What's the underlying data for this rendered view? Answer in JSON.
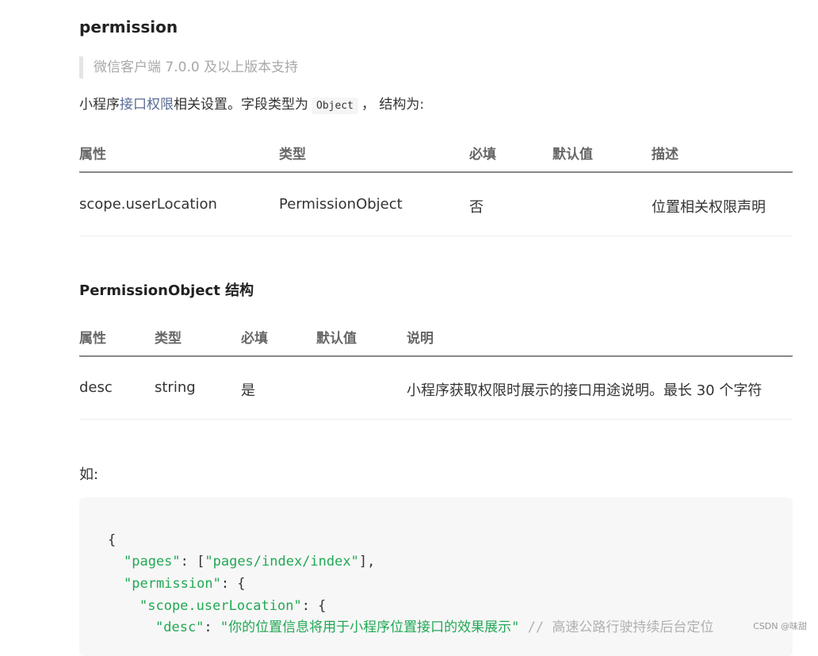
{
  "heading": "permission",
  "note": "微信客户端 7.0.0 及以上版本支持",
  "description": {
    "prefix": "小程序",
    "link": "接口权限",
    "middle": "相关设置。字段类型为",
    "code": "Object",
    "suffix": "， 结构为:"
  },
  "table1": {
    "headers": [
      "属性",
      "类型",
      "必填",
      "默认值",
      "描述"
    ],
    "rows": [
      [
        "scope.userLocation",
        "PermissionObject",
        "否",
        "",
        "位置相关权限声明"
      ]
    ]
  },
  "subheading": "PermissionObject 结构",
  "table2": {
    "headers": [
      "属性",
      "类型",
      "必填",
      "默认值",
      "说明"
    ],
    "rows": [
      [
        "desc",
        "string",
        "是",
        "",
        "小程序获取权限时展示的接口用途说明。最长 30 个字符"
      ]
    ]
  },
  "example_label": "如:",
  "code": {
    "line1": "{",
    "l2_key": "\"pages\"",
    "l2_colon": ": [",
    "l2_val": "\"pages/index/index\"",
    "l2_end": "],",
    "l3_key": "\"permission\"",
    "l3_end": ": {",
    "l4_key": "\"scope.userLocation\"",
    "l4_end": ": {",
    "l5_key": "\"desc\"",
    "l5_colon": ": ",
    "l5_val": "\"你的位置信息将用于小程序位置接口的效果展示\"",
    "l5_comment": " // 高速公路行驶持续后台定位"
  },
  "watermark": "CSDN @味甜"
}
